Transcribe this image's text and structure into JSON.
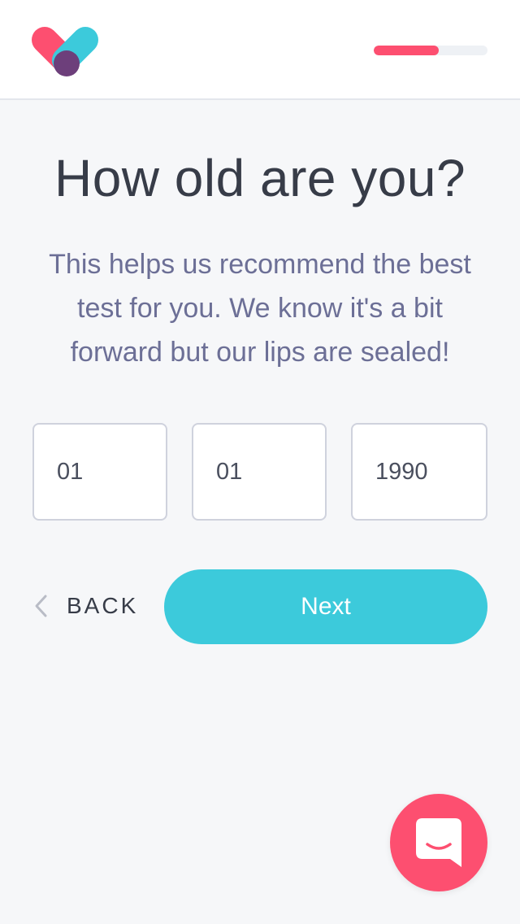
{
  "header": {
    "logo_icon": "heart-check-logo-icon",
    "progress": {
      "fraction": 0.57,
      "fill_color": "#fd4f70",
      "track_color": "#eef1f5"
    }
  },
  "main": {
    "title": "How old are you?",
    "subtitle": "This helps us recommend the best test for you. We know it's a bit forward but our lips are sealed!",
    "fields": {
      "day": "01",
      "month": "01",
      "year": "1990"
    }
  },
  "actions": {
    "back_label": "BACK",
    "back_icon": "chevron-left-icon",
    "next_label": "Next",
    "next_color": "#3ccadb"
  },
  "chat": {
    "icon": "chat-bubble-icon",
    "color": "#fd4f70"
  }
}
